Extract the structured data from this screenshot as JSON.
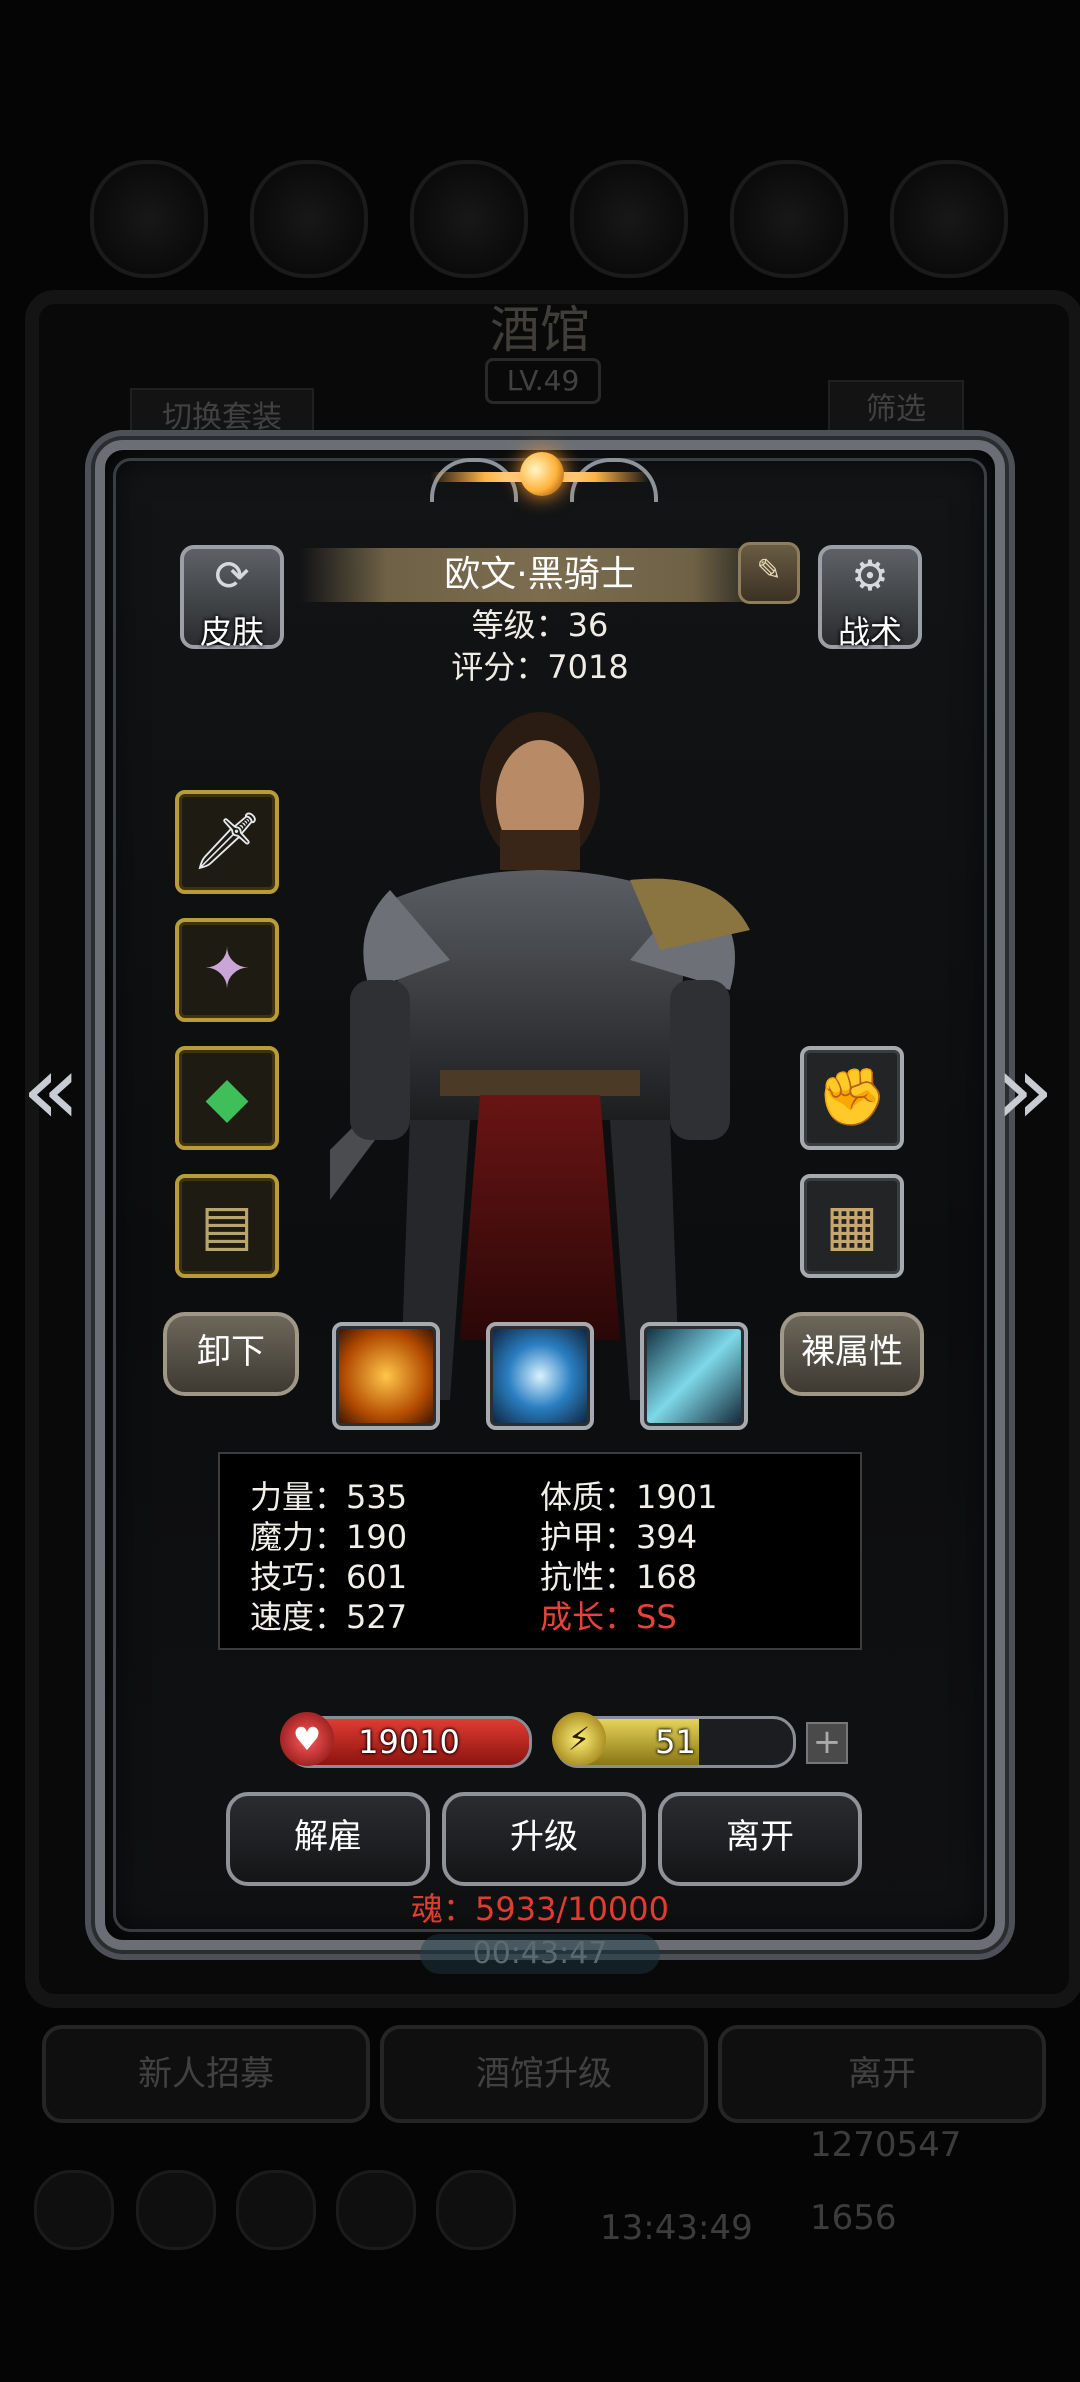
{
  "background": {
    "title": "酒馆",
    "level": "LV.49",
    "switch_outfit": "切换套装",
    "filter": "筛选",
    "bottom_buttons": [
      "新人招募",
      "酒馆升级",
      "离开"
    ],
    "gold": "1270547",
    "gems": "1656",
    "clock": "13:43:49"
  },
  "hero": {
    "name": "欧文·黑骑士",
    "level_line": "等级：36",
    "score_line": "评分：7018"
  },
  "buttons": {
    "skin": "皮肤",
    "tactics": "战术",
    "unequip": "卸下",
    "bare_stats": "裸属性",
    "dismiss": "解雇",
    "upgrade": "升级",
    "leave": "离开"
  },
  "icons": {
    "skin": "shirt-refresh-icon",
    "tactics": "gear-icon",
    "edit": "pencil-icon",
    "prev": "chevron-left-icon",
    "next": "chevron-right-icon"
  },
  "stats": {
    "strength": "力量：535",
    "magic": "魔力：190",
    "skill": "技巧：601",
    "speed": "速度：527",
    "constitution": "体质：1901",
    "armor": "护甲：394",
    "resistance": "抗性：168",
    "growth": "成长：SS"
  },
  "bars": {
    "hp": "19010",
    "energy": "51",
    "energy_fill": 0.6,
    "hp_color": "#c0201c",
    "energy_color": "#c9b238"
  },
  "soul": "魂：5933/10000",
  "timer": "00:43:47"
}
